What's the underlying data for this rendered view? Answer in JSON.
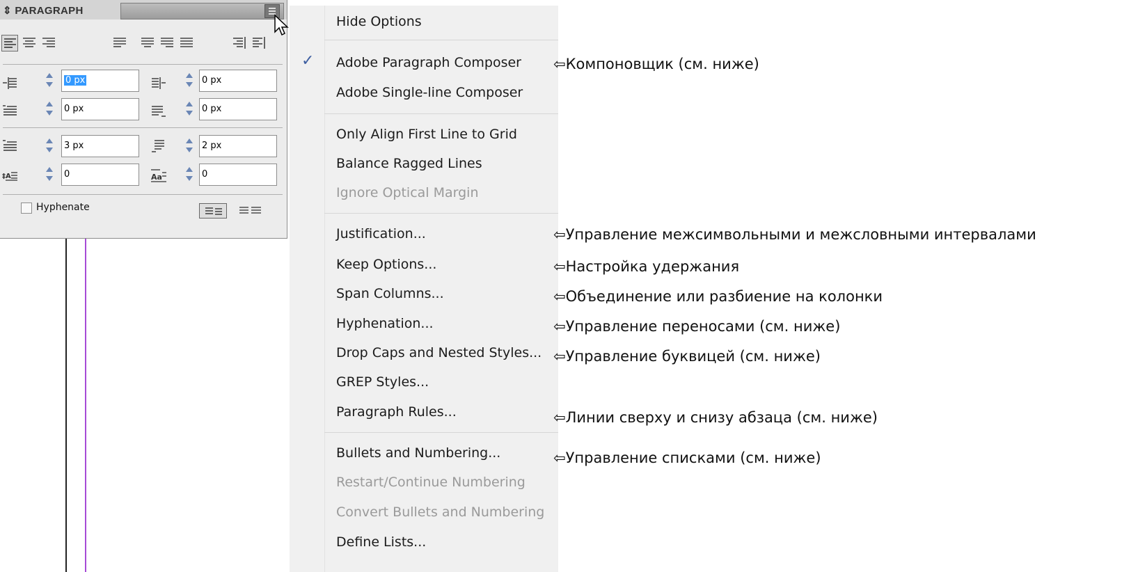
{
  "panel": {
    "title": "PARAGRAPH",
    "fields": {
      "left_indent": "0 px",
      "right_indent": "0 px",
      "first_line_left_indent": "0 px",
      "last_line_right_indent": "0 px",
      "space_before": "3 px",
      "space_after": "2 px",
      "drop_cap_lines": "0",
      "drop_cap_chars": "0"
    },
    "hyphenate_label": "Hyphenate",
    "hyphenate_checked": false
  },
  "menu": {
    "items": [
      {
        "label": "Hide Options",
        "enabled": true
      },
      {
        "label": "Adobe Paragraph Composer",
        "enabled": true,
        "checked": true
      },
      {
        "label": "Adobe Single-line Composer",
        "enabled": true
      },
      {
        "label": "Only Align First Line to Grid",
        "enabled": true
      },
      {
        "label": "Balance Ragged Lines",
        "enabled": true
      },
      {
        "label": "Ignore Optical Margin",
        "enabled": false
      },
      {
        "label": "Justification...",
        "enabled": true
      },
      {
        "label": "Keep Options...",
        "enabled": true
      },
      {
        "label": "Span Columns...",
        "enabled": true
      },
      {
        "label": "Hyphenation...",
        "enabled": true
      },
      {
        "label": "Drop Caps and Nested Styles...",
        "enabled": true
      },
      {
        "label": "GREP Styles...",
        "enabled": true
      },
      {
        "label": "Paragraph Rules...",
        "enabled": true
      },
      {
        "label": "Bullets and Numbering...",
        "enabled": true
      },
      {
        "label": "Restart/Continue Numbering",
        "enabled": false
      },
      {
        "label": "Convert Bullets and Numbering",
        "enabled": false
      },
      {
        "label": "Define Lists...",
        "enabled": true
      }
    ],
    "check_glyph": "✓"
  },
  "annotations": {
    "composer": "⇦Компоновщик (см. ниже)",
    "justification": "⇦Управление межсимвольными и межсловными интервалами",
    "keep": "⇦Настройка удержания",
    "span": "⇦Объединение или разбиение на колонки",
    "hyphenation": "⇦Управление переносами (см. ниже)",
    "dropcaps": "⇦Управление буквицей (см. ниже)",
    "rules": "⇦Линии сверху и снизу абзаца (см. ниже)",
    "bullets": "⇦Управление списками (см. ниже)"
  },
  "colors": {
    "check": "#3e5fa1",
    "guide_purple": "#a64ad6",
    "selection": "#3399ff"
  }
}
